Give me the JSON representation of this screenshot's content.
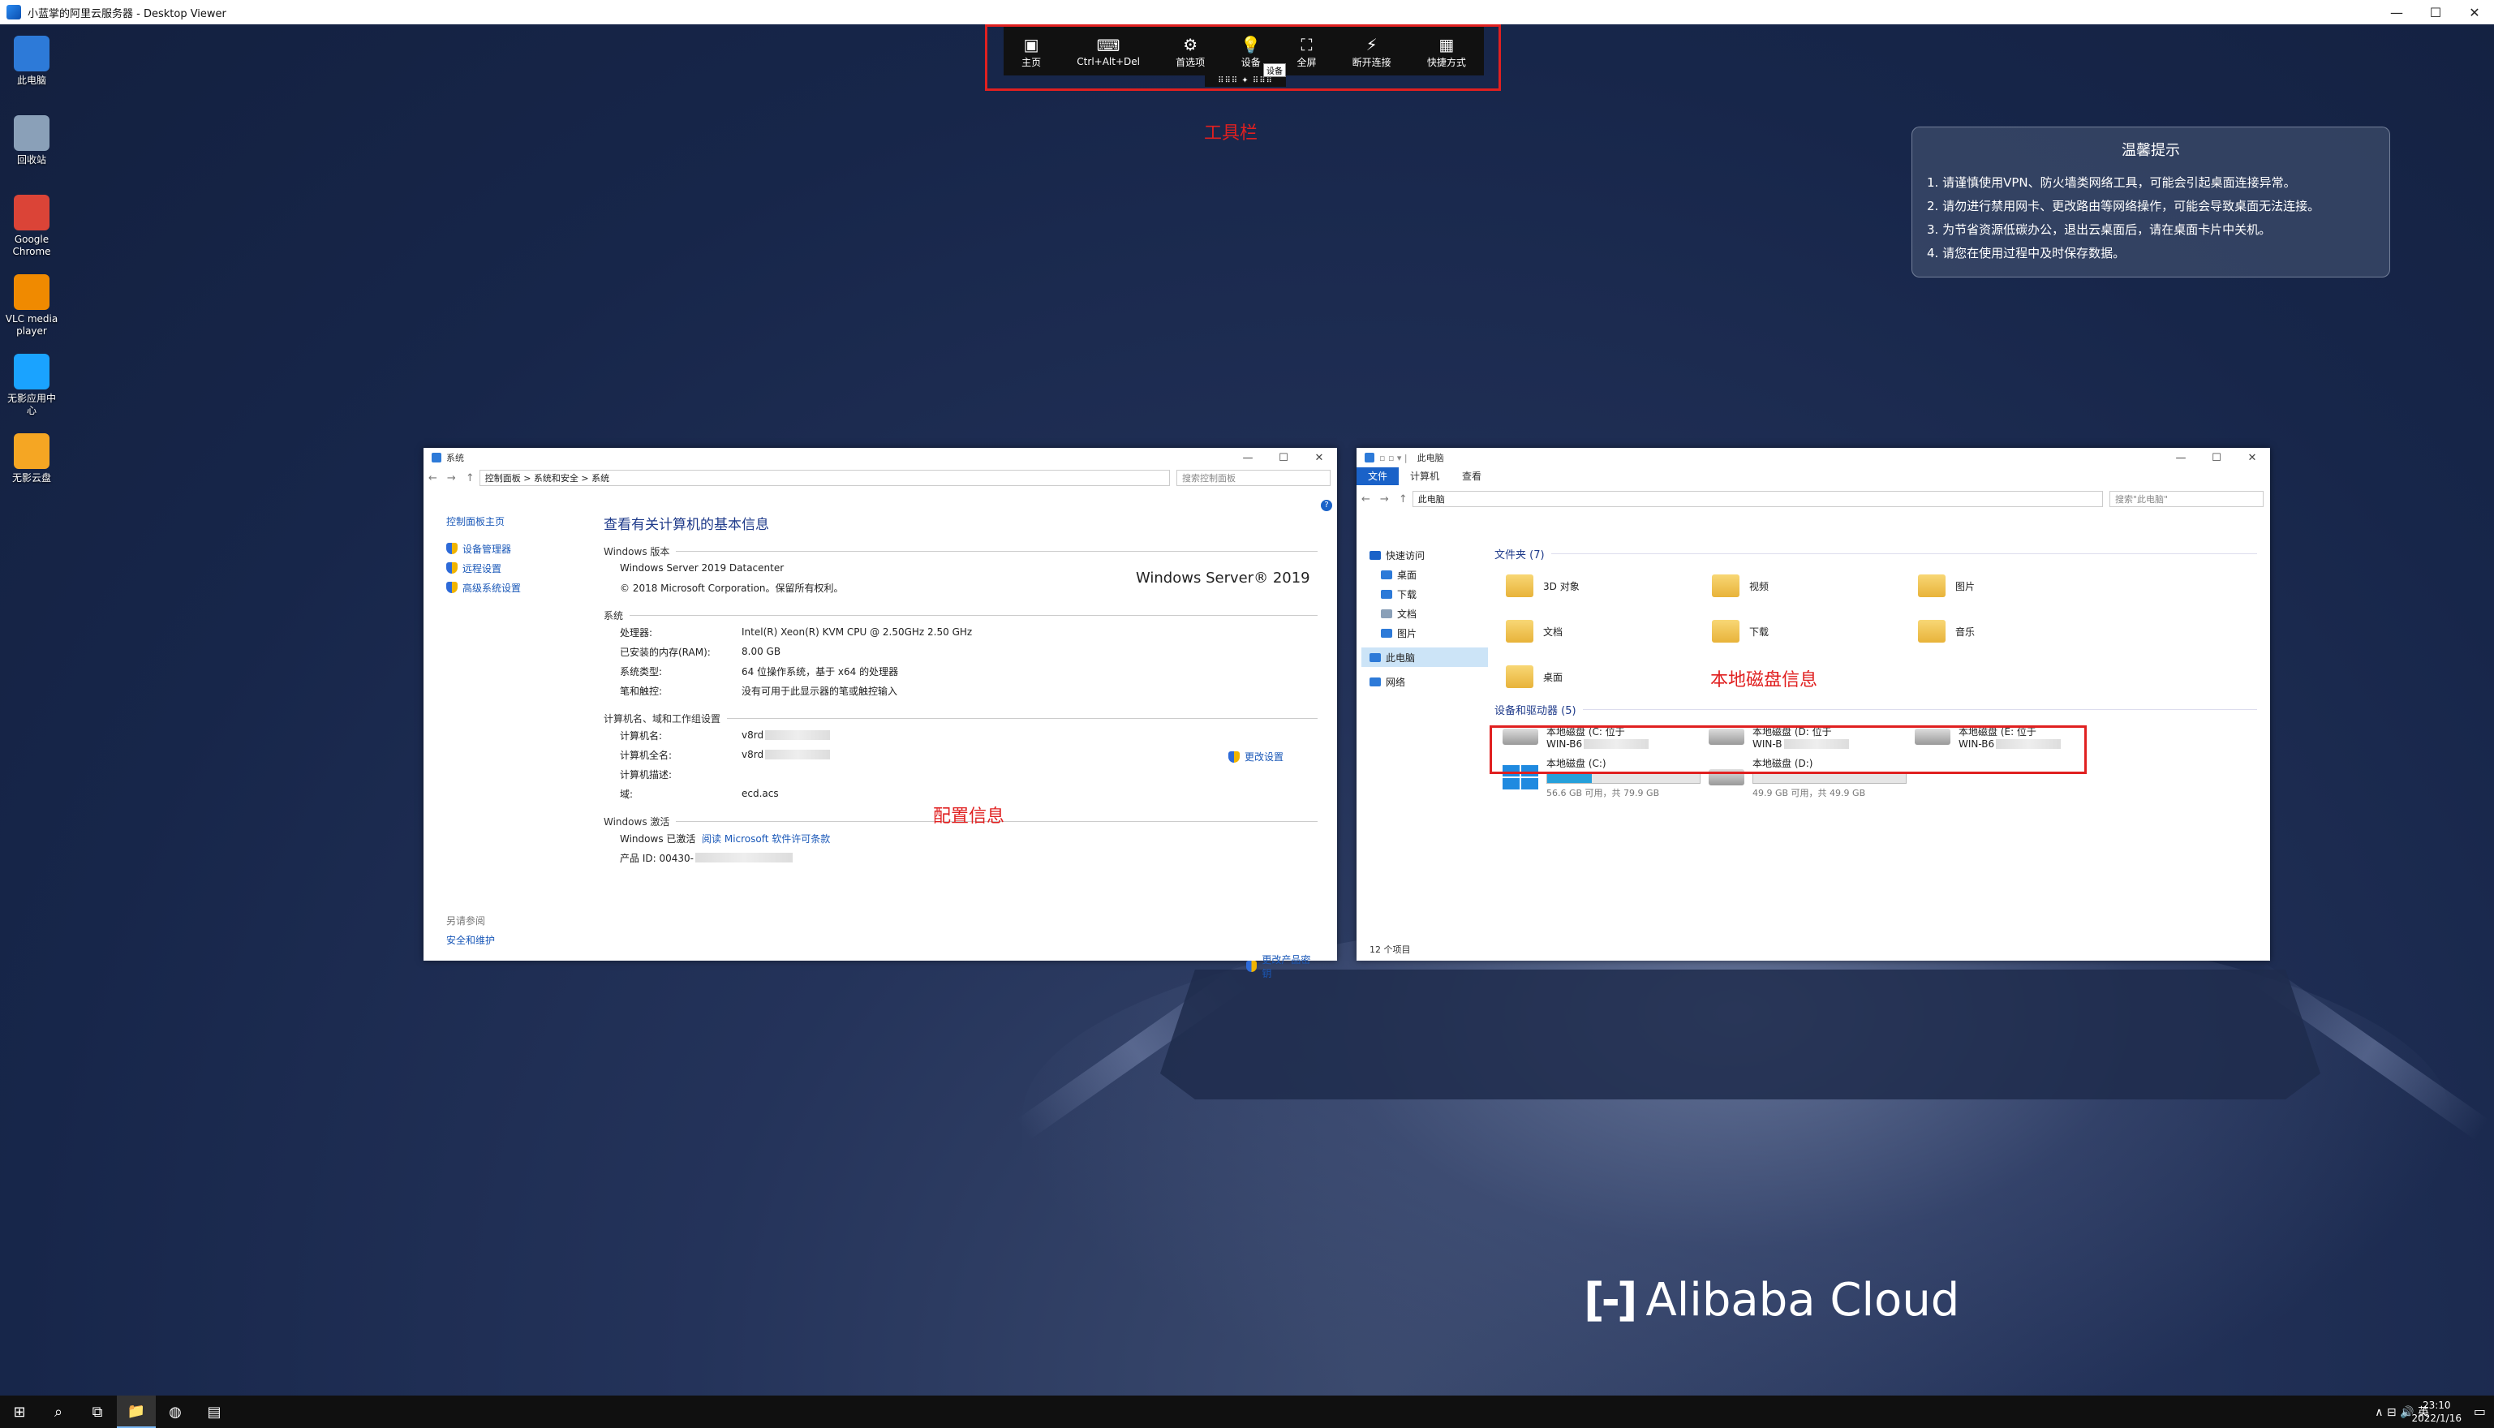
{
  "app": {
    "title": "小蓝掌的阿里云服务器 - Desktop Viewer",
    "minimize": "—",
    "maximize": "☐",
    "close": "✕"
  },
  "desktop_icons": [
    {
      "label": "此电脑",
      "icon": "computer-icon",
      "color": "#2d7ad8"
    },
    {
      "label": "回收站",
      "icon": "recycle-bin-icon",
      "color": "#8aa0b8"
    },
    {
      "label": "Google\nChrome",
      "icon": "chrome-icon",
      "color": "#db4437"
    },
    {
      "label": "VLC media\nplayer",
      "icon": "vlc-icon",
      "color": "#f08a00"
    },
    {
      "label": "无影应用中心",
      "icon": "app-center-icon",
      "color": "#1aa3ff"
    },
    {
      "label": "无影云盘",
      "icon": "cloud-disk-icon",
      "color": "#f5a623"
    }
  ],
  "toolbar": {
    "buttons": [
      {
        "label": "主页",
        "glyph": "▣"
      },
      {
        "label": "Ctrl+Alt+Del",
        "glyph": "⌨"
      },
      {
        "label": "首选项",
        "glyph": "⚙"
      },
      {
        "label": "设备",
        "glyph": "💡"
      },
      {
        "label": "全屏",
        "glyph": "⛶"
      },
      {
        "label": "断开连接",
        "glyph": "⚡"
      },
      {
        "label": "快捷方式",
        "glyph": "▦"
      }
    ],
    "handle": "⠿⠿⠿ ✦ ⠿⠿⠿",
    "tooltip": "设备",
    "annotation": "工具栏"
  },
  "notice": {
    "title": "温馨提示",
    "items": [
      "1. 请谨慎使用VPN、防火墙类网络工具，可能会引起桌面连接异常。",
      "2. 请勿进行禁用网卡、更改路由等网络操作，可能会导致桌面无法连接。",
      "3. 为节省资源低碳办公，退出云桌面后，请在桌面卡片中关机。",
      "4. 请您在使用过程中及时保存数据。"
    ]
  },
  "system_window": {
    "title": "系统",
    "breadcrumb": "控制面板  >  系统和安全  >  系统",
    "search_placeholder": "搜索控制面板",
    "side": {
      "home": "控制面板主页",
      "links": [
        "设备管理器",
        "远程设置",
        "高级系统设置"
      ],
      "see_also": "另请参阅",
      "security": "安全和维护"
    },
    "heading": "查看有关计算机的基本信息",
    "win_edition": {
      "section": "Windows 版本",
      "edition": "Windows Server 2019 Datacenter",
      "copyright": "© 2018 Microsoft Corporation。保留所有权利。",
      "logo": "Windows Server® 2019"
    },
    "system": {
      "section": "系统",
      "rows": [
        {
          "k": "处理器:",
          "v": "Intel(R) Xeon(R) KVM CPU @ 2.50GHz   2.50 GHz"
        },
        {
          "k": "已安装的内存(RAM):",
          "v": "8.00 GB"
        },
        {
          "k": "系统类型:",
          "v": "64 位操作系统，基于 x64 的处理器"
        },
        {
          "k": "笔和触控:",
          "v": "没有可用于此显示器的笔或触控输入"
        }
      ]
    },
    "computer": {
      "section": "计算机名、域和工作组设置",
      "rows": [
        {
          "k": "计算机名:",
          "v": "v8rd"
        },
        {
          "k": "计算机全名:",
          "v": "v8rd"
        },
        {
          "k": "计算机描述:",
          "v": ""
        },
        {
          "k": "域:",
          "v": "ecd.acs"
        }
      ],
      "change": "更改设置"
    },
    "activation": {
      "section": "Windows 激活",
      "status": "Windows 已激活",
      "license_link": "阅读 Microsoft 软件许可条款",
      "product_id": "产品 ID: 00430-",
      "change_key": "更改产品密钥"
    },
    "annotation": "配置信息"
  },
  "explorer_window": {
    "title": "此电脑",
    "tabs": [
      "文件",
      "计算机",
      "查看"
    ],
    "breadcrumb": "此电脑",
    "search_placeholder": "搜索\"此电脑\"",
    "tree": [
      {
        "label": "快速访问",
        "color": "#1a62c8"
      },
      {
        "label": "桌面",
        "color": "#2d7ad8"
      },
      {
        "label": "下载",
        "color": "#2d7ad8"
      },
      {
        "label": "文档",
        "color": "#8aa0b8"
      },
      {
        "label": "图片",
        "color": "#2d7ad8"
      },
      {
        "label": "此电脑",
        "color": "#2d7ad8"
      },
      {
        "label": "网络",
        "color": "#2d7ad8"
      }
    ],
    "folders_header": "文件夹 (7)",
    "folders": [
      "3D 对象",
      "视频",
      "图片",
      "文档",
      "下载",
      "音乐",
      "桌面"
    ],
    "devices_header": "设备和驱动器 (5)",
    "mapped": [
      {
        "name": "本地磁盘 (C: 位于",
        "host": "WIN-B6"
      },
      {
        "name": "本地磁盘 (D: 位于",
        "host": "WIN-B"
      },
      {
        "name": "本地磁盘 (E: 位于",
        "host": "WIN-B6"
      }
    ],
    "local": [
      {
        "name": "本地磁盘 (C:)",
        "info": "56.6 GB 可用，共 79.9 GB",
        "used_fraction": 0.29,
        "windows": true
      },
      {
        "name": "本地磁盘 (D:)",
        "info": "49.9 GB 可用，共 49.9 GB",
        "used_fraction": 0.0,
        "windows": false
      }
    ],
    "status": "12 个项目",
    "annotation": "本地磁盘信息"
  },
  "brand": "Alibaba Cloud",
  "taskbar": {
    "buttons": [
      "windows-start-icon",
      "search-icon",
      "task-view-icon",
      "file-explorer-icon",
      "edge-icon",
      "server-manager-icon"
    ],
    "tray": "∧  ⊟  🔊  英",
    "time": "23:10",
    "date": "2022/1/16"
  }
}
